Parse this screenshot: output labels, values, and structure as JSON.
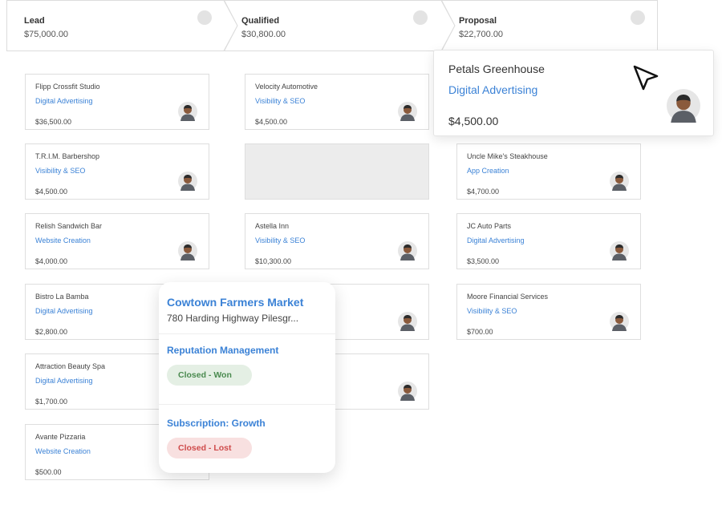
{
  "stages": [
    {
      "title": "Lead",
      "amount": "$75,000.00"
    },
    {
      "title": "Qualified",
      "amount": "$30,800.00"
    },
    {
      "title": "Proposal",
      "amount": "$22,700.00"
    }
  ],
  "columns": [
    [
      {
        "name": "Flipp Crossfit Studio",
        "service": "Digital Advertising",
        "amount": "$36,500.00"
      },
      {
        "name": "T.R.I.M. Barbershop",
        "service": "Visibility & SEO",
        "amount": "$4,500.00"
      },
      {
        "name": "Relish Sandwich Bar",
        "service": "Website Creation",
        "amount": "$4,000.00"
      },
      {
        "name": "Bistro La Bamba",
        "service": "Digital Advertising",
        "amount": "$2,800.00"
      },
      {
        "name": "Attraction Beauty Spa",
        "service": "Digital Advertising",
        "amount": "$1,700.00"
      },
      {
        "name": "Avante Pizzaria",
        "service": "Website Creation",
        "amount": "$500.00"
      }
    ],
    [
      {
        "name": "Velocity Automotive",
        "service": "Visibility & SEO",
        "amount": "$4,500.00"
      },
      {
        "name": "Astella Inn",
        "service": "Visibility & SEO",
        "amount": "$10,300.00"
      }
    ],
    [
      {
        "name": "Uncle Mike's Steakhouse",
        "service": "App Creation",
        "amount": "$4,700.00"
      },
      {
        "name": "JC Auto Parts",
        "service": "Digital Advertising",
        "amount": "$3,500.00"
      },
      {
        "name": "Moore Financial Services",
        "service": "Visibility & SEO",
        "amount": "$700.00"
      }
    ]
  ],
  "dragged_card": {
    "name": "Petals Greenhouse",
    "service": "Digital Advertising",
    "amount": "$4,500.00"
  },
  "detail_popup": {
    "name": "Cowtown Farmers Market",
    "address": "780 Harding Highway Pilesgr...",
    "items": [
      {
        "service": "Reputation Management",
        "status": "Closed - Won"
      },
      {
        "service": "Subscription: Growth",
        "status": "Closed - Lost"
      }
    ]
  },
  "colors": {
    "link_blue": "#3b82d6",
    "won_bg": "#e4efe4",
    "won_text": "#4a8a4f",
    "lost_bg": "#f8e0e0",
    "lost_text": "#cf4b4b"
  }
}
